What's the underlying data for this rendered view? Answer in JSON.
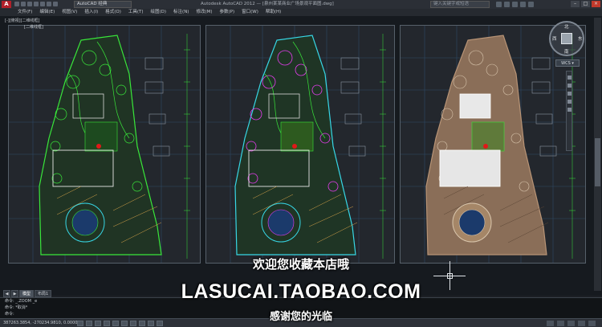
{
  "titlebar": {
    "app_logo": "A",
    "workspace": "AutoCAD 经典",
    "window_title": "Autodesk AutoCAD 2012 — [泉州某某商业广场景观平面图.dwg]",
    "search_placeholder": "键入关键字或短语",
    "minimize": "–",
    "maximize": "□",
    "close": "×"
  },
  "menu": [
    "文件(F)",
    "编辑(E)",
    "视图(V)",
    "插入(I)",
    "格式(O)",
    "工具(T)",
    "绘图(D)",
    "标注(N)",
    "修改(M)",
    "参数(P)",
    "窗口(W)",
    "帮助(H)"
  ],
  "viewport": {
    "tag": "[-][俯视][二维线框]",
    "tag2": "[二维线框]"
  },
  "viewcube": {
    "north": "北",
    "south": "南",
    "west": "西",
    "east": "东",
    "wcs": "WCS ▾"
  },
  "overlay": {
    "line1": "欢迎您收藏本店哦",
    "line2": "LASUCAI.TAOBAO.COM",
    "line3": "感谢您的光临"
  },
  "tabs": {
    "nav_first": "◀",
    "nav_next": "▶",
    "model": "模型",
    "layout": "布局1"
  },
  "command": {
    "line1": "命令: _.ZOOM _e",
    "line2": "命令: *取消*",
    "line3": "命令:"
  },
  "status": {
    "coords": "387263.3854, -270234.9810, 0.0000"
  },
  "colors": {
    "plan_green": "#39e63a",
    "plan_magenta": "#e83cf0",
    "plan_cyan": "#37d7e6",
    "plan_tan": "#b89476",
    "hatch_orange": "#d8a44a",
    "red_marker": "#e01818"
  }
}
